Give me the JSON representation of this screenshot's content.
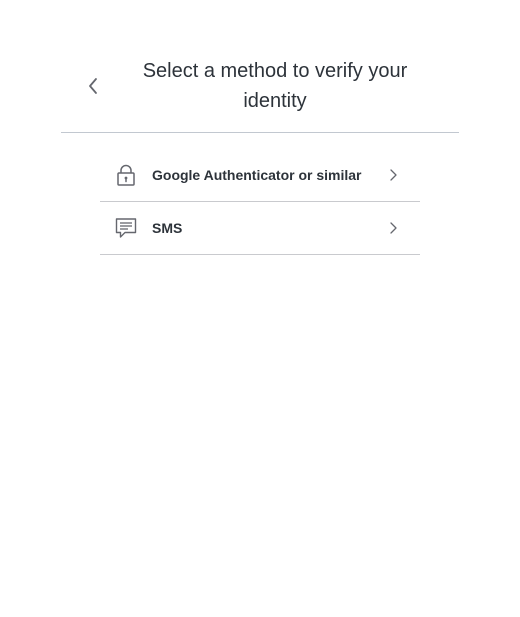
{
  "header": {
    "title": "Select a method to verify your identity",
    "back_icon": "chevron-left-icon"
  },
  "methods": [
    {
      "label": "Google Authenticator or similar",
      "icon": "lock-icon"
    },
    {
      "label": "SMS",
      "icon": "message-icon"
    }
  ],
  "colors": {
    "text": "#2d333a",
    "divider": "#c2c8d0",
    "icon": "#65676e"
  }
}
